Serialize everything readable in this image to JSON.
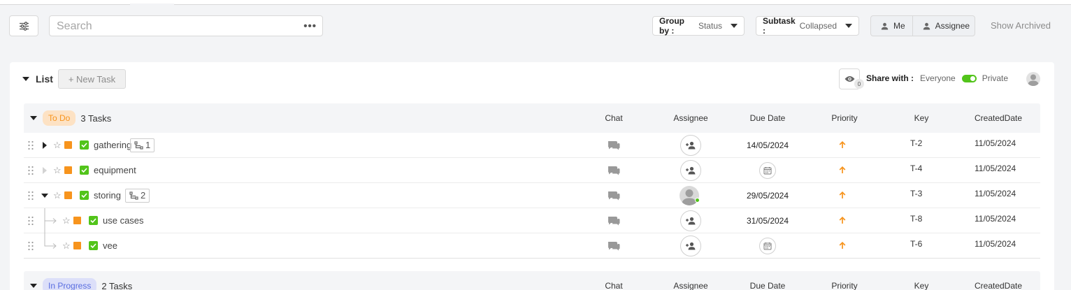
{
  "toolbar": {
    "search_placeholder": "Search",
    "more_label": "•••",
    "group_by": {
      "label": "Group by :",
      "value": "Status"
    },
    "subtask": {
      "label": "Subtask :",
      "value": "Collapsed"
    },
    "filters": [
      "Me",
      "Assignee"
    ],
    "show_archived": "Show Archived"
  },
  "list": {
    "title": "List",
    "new_task": "+ New Task",
    "watchers_count": "0",
    "share_label": "Share with :",
    "share_left": "Everyone",
    "share_right": "Private",
    "share_toggle_private": true
  },
  "columns": [
    "Chat",
    "Assignee",
    "Due Date",
    "Priority",
    "Key",
    "CreatedDate"
  ],
  "groups": [
    {
      "status": "To Do",
      "count": "3 Tasks",
      "tasks": [
        {
          "name": "gathering",
          "subtasks": "1",
          "expanded": false,
          "due": "14/05/2024",
          "key": "T-2",
          "created": "11/05/2024",
          "assigned": false
        },
        {
          "name": "equipment",
          "subtasks": "",
          "due": "",
          "key": "T-4",
          "created": "11/05/2024",
          "assigned": false
        },
        {
          "name": "storing",
          "subtasks": "2",
          "expanded": true,
          "due": "29/05/2024",
          "key": "T-3",
          "created": "11/05/2024",
          "assigned": true
        },
        {
          "name": "use cases",
          "subtask_of": "storing",
          "due": "31/05/2024",
          "key": "T-8",
          "created": "11/05/2024",
          "assigned": false
        },
        {
          "name": "vee",
          "subtask_of": "storing",
          "due": "",
          "key": "T-6",
          "created": "11/05/2024",
          "assigned": false
        }
      ]
    },
    {
      "status": "In Progress",
      "count": "2 Tasks"
    }
  ],
  "colors": {
    "todo": "#f7941d",
    "todo_bg": "#fde2c4",
    "in_progress": "#5a6ee0",
    "in_progress_bg": "#dcdff9",
    "done_check": "#52c41a",
    "toggle_on": "#52c41a"
  }
}
